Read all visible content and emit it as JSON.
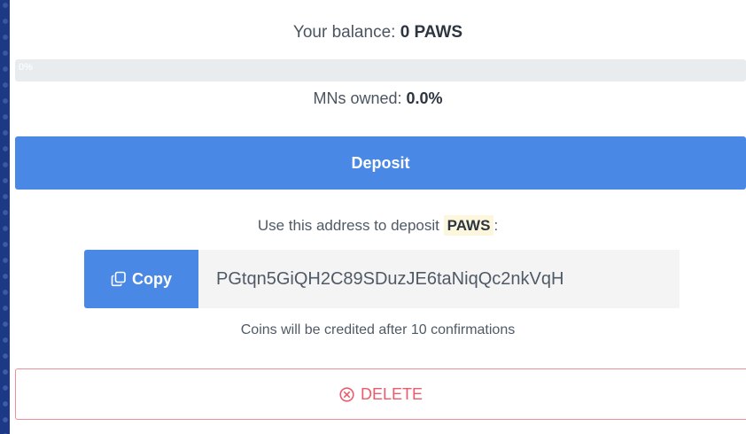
{
  "balance": {
    "label": "Your balance:",
    "value": "0 PAWS"
  },
  "progress": {
    "text": "0%",
    "fraction": 0.0
  },
  "masternodes": {
    "label": "MNs owned:",
    "value": "0.0%"
  },
  "deposit": {
    "button_label": "Deposit"
  },
  "address_section": {
    "instruction_prefix": "Use this address to deposit",
    "coin": "PAWS",
    "instruction_suffix": ":",
    "copy_label": "Copy",
    "copy_icon": "copy-icon",
    "address": "PGtqn5GiQH2C89SDuzJE6taNiqQc2nkVqH",
    "confirmations_note": "Coins will be credited after 10 confirmations"
  },
  "delete": {
    "button_label": "DELETE",
    "icon": "circle-x-icon"
  },
  "colors": {
    "primary": "#4a88e6",
    "danger": "#ef5a6b",
    "background": "#1d3d8c"
  }
}
